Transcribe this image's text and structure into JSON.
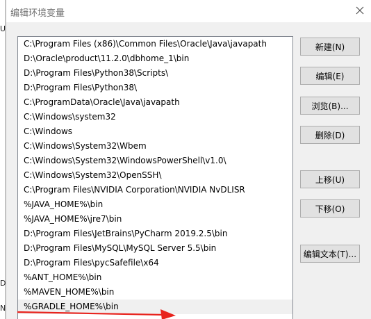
{
  "dialog": {
    "title": "编辑环境变量",
    "close_label": "×"
  },
  "background": {
    "glyphs": [
      "U",
      "D",
      "N"
    ]
  },
  "path_list": {
    "items": [
      "C:\\Program Files (x86)\\Common Files\\Oracle\\Java\\javapath",
      "D:\\Oracle\\product\\11.2.0\\dbhome_1\\bin",
      "D:\\Program Files\\Python38\\Scripts\\",
      "D:\\Program Files\\Python38\\",
      "C:\\ProgramData\\Oracle\\Java\\javapath",
      "C:\\Windows\\system32",
      "C:\\Windows",
      "C:\\Windows\\System32\\Wbem",
      "C:\\Windows\\System32\\WindowsPowerShell\\v1.0\\",
      "C:\\Windows\\System32\\OpenSSH\\",
      "C:\\Program Files\\NVIDIA Corporation\\NVIDIA NvDLISR",
      "%JAVA_HOME%\\bin",
      "%JAVA_HOME%\\jre7\\bin",
      "D:\\Program Files\\JetBrains\\PyCharm 2019.2.5\\bin",
      "D:\\Program Files\\MySQL\\MySQL Server 5.5\\bin",
      "D:\\Program Files\\pycSafefile\\x64",
      "%ANT_HOME%\\bin",
      "%MAVEN_HOME%\\bin",
      "%GRADLE_HOME%\\bin"
    ],
    "selected_index": 18
  },
  "buttons": {
    "new": "新建(N)",
    "edit": "编辑(E)",
    "browse": "浏览(B)...",
    "delete": "删除(D)",
    "move_up": "上移(U)",
    "move_down": "下移(O)",
    "edit_text": "编辑文本(T)..."
  },
  "colors": {
    "annotation_arrow": "#e8231d",
    "selection": "#f0f0f0",
    "button_face": "#e1e1e1"
  }
}
